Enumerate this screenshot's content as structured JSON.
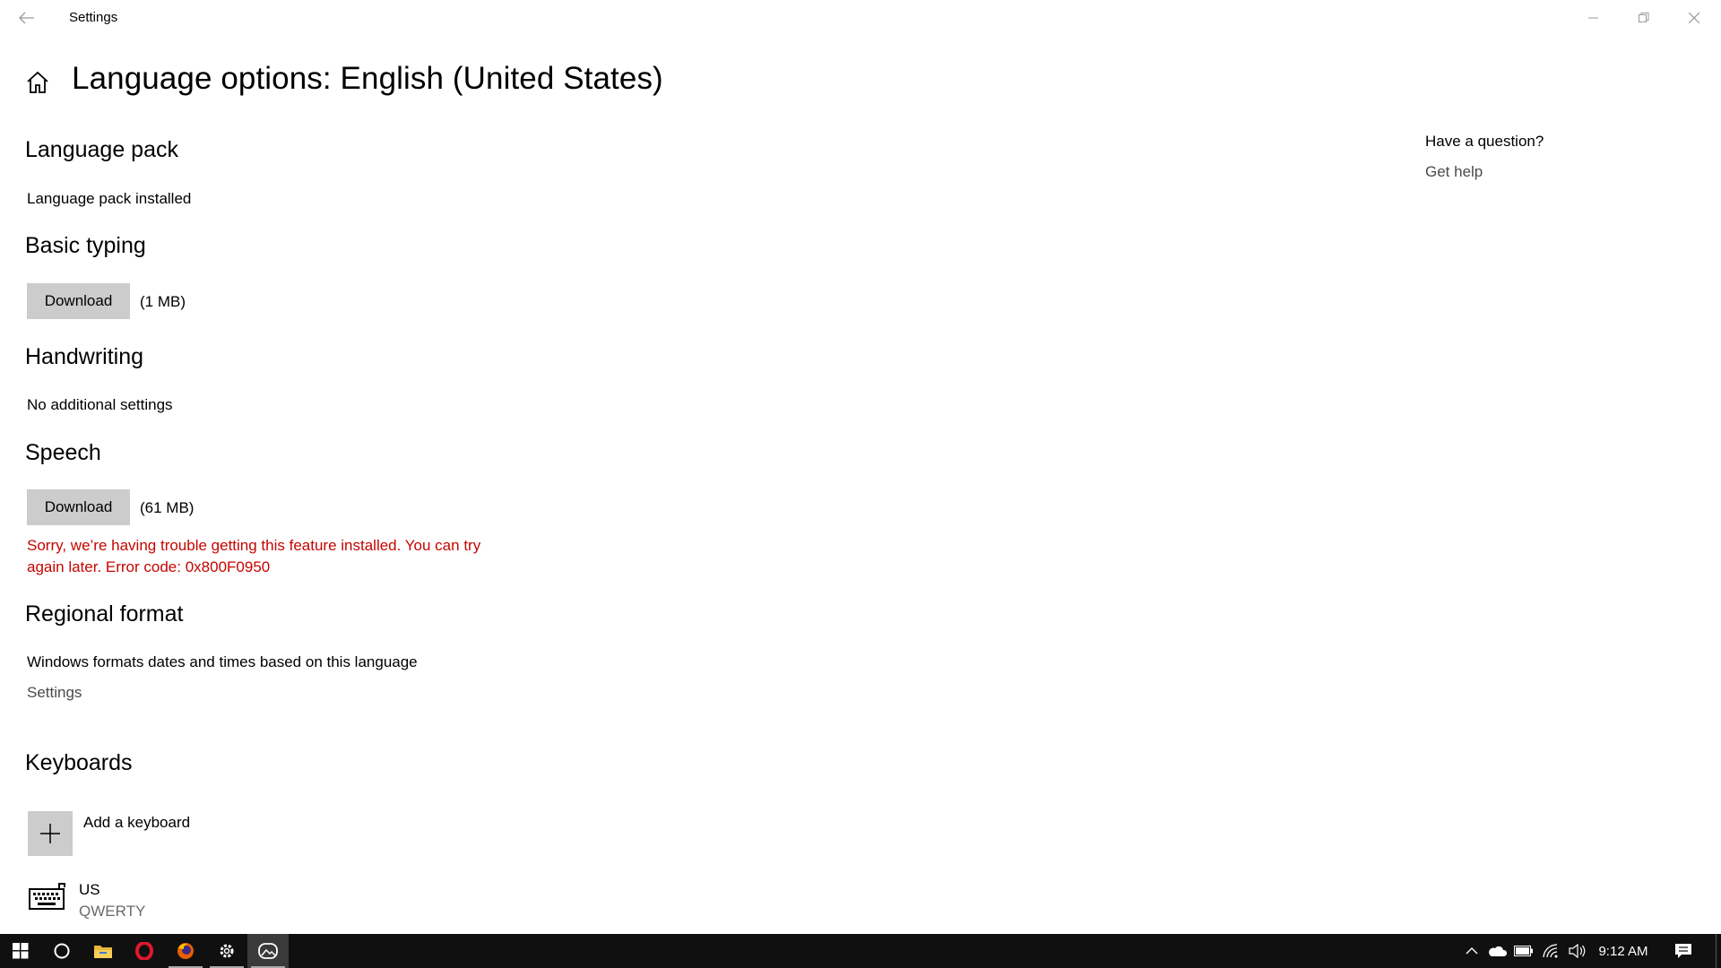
{
  "window": {
    "title": "Settings"
  },
  "page": {
    "title": "Language options: English (United States)"
  },
  "sections": {
    "language_pack": {
      "heading": "Language pack",
      "status": "Language pack installed"
    },
    "basic_typing": {
      "heading": "Basic typing",
      "button": "Download",
      "size": "(1 MB)"
    },
    "handwriting": {
      "heading": "Handwriting",
      "status": "No additional settings"
    },
    "speech": {
      "heading": "Speech",
      "button": "Download",
      "size": "(61 MB)",
      "error_line1": "Sorry, we’re having trouble getting this feature installed. You can try",
      "error_line2": "again later. Error code: 0x800F0950"
    },
    "regional_format": {
      "heading": "Regional format",
      "description": "Windows formats dates and times based on this language",
      "link": "Settings"
    },
    "keyboards": {
      "heading": "Keyboards",
      "add_label": "Add a keyboard",
      "items": [
        {
          "name": "US",
          "layout": "QWERTY"
        }
      ]
    }
  },
  "help": {
    "question": "Have a question?",
    "link": "Get help"
  },
  "taskbar": {
    "clock": "9:12 AM",
    "apps": [
      "start-icon",
      "cortana-icon",
      "file-explorer-icon",
      "opera-icon",
      "firefox-icon",
      "settings-gear-icon",
      "photos-app-icon"
    ],
    "tray": [
      "chevron-up-icon",
      "onedrive-cloud-icon",
      "battery-icon",
      "wifi-icon",
      "volume-icon",
      "action-center-icon"
    ]
  },
  "colors": {
    "error": "#c50500",
    "button_bg": "#cccccc",
    "taskbar_bg": "#101010"
  }
}
